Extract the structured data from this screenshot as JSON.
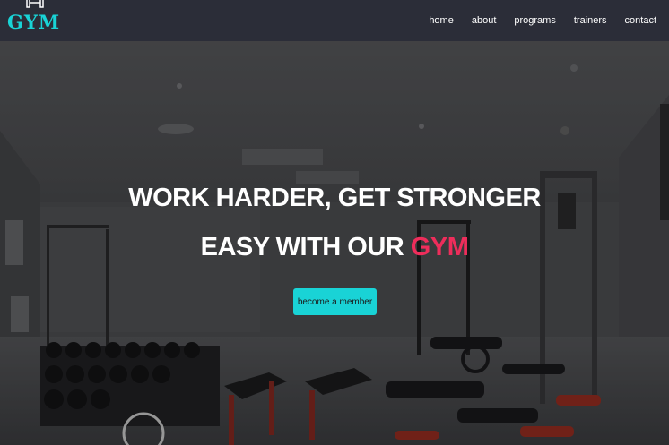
{
  "brand": {
    "name": "GYM",
    "icon": "dumbbell-icon",
    "color": "#19d3d6"
  },
  "nav": {
    "items": [
      {
        "label": "home"
      },
      {
        "label": "about"
      },
      {
        "label": "programs"
      },
      {
        "label": "trainers"
      },
      {
        "label": "contact"
      }
    ]
  },
  "hero": {
    "line1": "WORK HARDER, GET STRONGER",
    "line2_prefix": "EASY WITH OUR ",
    "line2_accent": "GYM",
    "accent_color": "#ee2d5b",
    "cta_label": "become a member"
  }
}
